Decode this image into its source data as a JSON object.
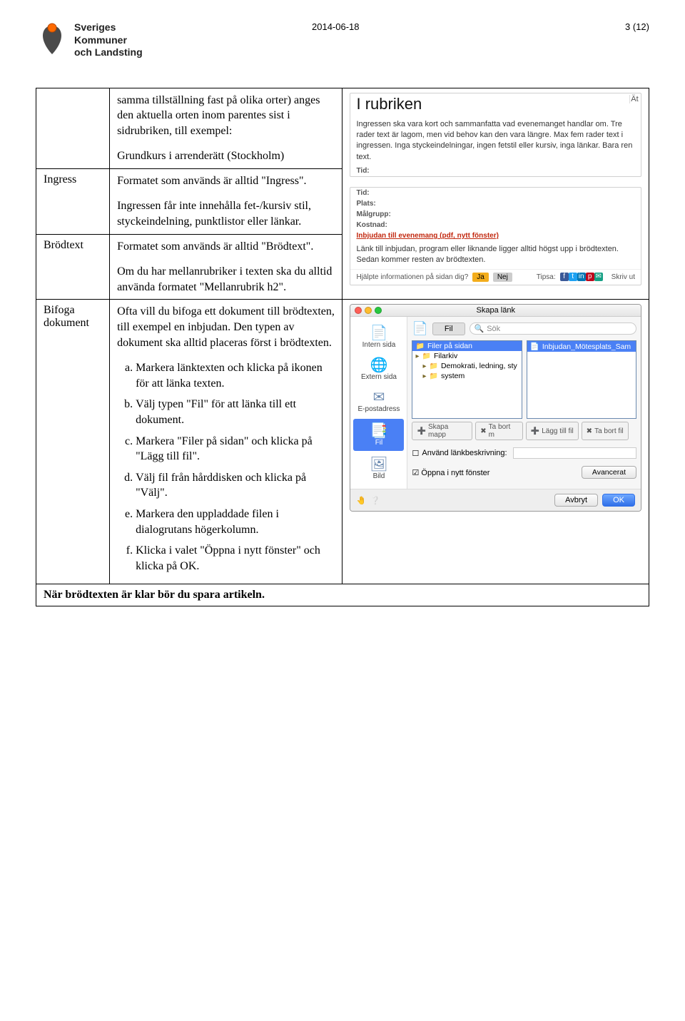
{
  "header": {
    "org_line1": "Sveriges",
    "org_line2": "Kommuner",
    "org_line3": "och Landsting",
    "date": "2014-06-18",
    "pager": "3 (12)"
  },
  "rows": {
    "r0": {
      "body_p1": "samma tillställning fast på olika orter) anges den aktuella orten inom parentes sist i sidrubriken, till exempel:",
      "body_p2": "Grundkurs i arrenderätt (Stockholm)"
    },
    "ingress": {
      "label": "Ingress",
      "p1": "Formatet som används är alltid \"Ingress\".",
      "p2": "Ingressen får inte innehålla fet-/kursiv stil, styckeindelning, punktlistor eller länkar."
    },
    "brodtext": {
      "label": "Brödtext",
      "p1": "Formatet som används är alltid \"Brödtext\".",
      "p2": "Om du har mellanrubriker i texten ska du alltid använda formatet \"Mellanrubrik h2\"."
    },
    "bifoga": {
      "label": "Bifoga dokument",
      "p1": "Ofta vill du bifoga ett dokument till brödtexten, till exempel en inbjudan. Den typen av dokument ska alltid placeras först i brödtexten.",
      "a": "Markera länktexten och klicka på ikonen för att länka texten.",
      "b": "Välj typen \"Fil\" för att länka till ett dokument.",
      "c": "Markera \"Filer på sidan\" och klicka på \"Lägg till fil\".",
      "d": "Välj fil från hårddisken och klicka på \"Välj\".",
      "e": "Markera den uppladdade filen i dialogrutans högerkolumn.",
      "f": "Klicka i valet \"Öppna i nytt fönster\" och klicka på OK."
    }
  },
  "footer_note": "När brödtexten är klar bör du spara artikeln.",
  "shot1": {
    "rubrik": "I rubriken",
    "at": "Ät",
    "desc": "Ingressen ska vara kort och sammanfatta vad evenemanget handlar om. Tre rader text är lagom, men vid behov kan den vara längre. Max fem rader text i ingressen. Inga styckeindelningar, ingen fetstil eller kursiv, inga länkar. Bara ren text.",
    "tid": "Tid:"
  },
  "shot2": {
    "tid": "Tid:",
    "plats": "Plats:",
    "malgrupp": "Målgrupp:",
    "kostnad": "Kostnad:",
    "link": "Inbjudan till evenemang (pdf, nytt fönster)",
    "desc": "Länk till inbjudan, program eller liknande ligger alltid högst upp i brödtexten. Sedan kommer resten av brödtexten.",
    "footer_q": "Hjälpte informationen på sidan dig?",
    "yes": "Ja",
    "no": "Nej",
    "tipsa": "Tipsa:",
    "skrivut": "Skriv ut"
  },
  "dlg": {
    "title": "Skapa länk",
    "side_intern": "Intern sida",
    "side_extern": "Extern sida",
    "side_email": "E-postadress",
    "side_fil": "Fil",
    "side_bild": "Bild",
    "tab_fil": "Fil",
    "search_ph": "Sök",
    "left_item1": "Filer på sidan",
    "left_item2": "Filarkiv",
    "left_item3": "Demokrati, ledning, sty",
    "left_item4": "system",
    "right_item1": "Inbjudan_Mötesplats_Sam",
    "skapa": "Skapa mapp",
    "tabort": "Ta bort m",
    "lagg": "Lägg till fil",
    "tabortfil": "Ta bort fil",
    "check1": "Använd länkbeskrivning:",
    "check2": "Öppna i nytt fönster",
    "avancerat": "Avancerat",
    "avbryt": "Avbryt",
    "ok": "OK"
  }
}
